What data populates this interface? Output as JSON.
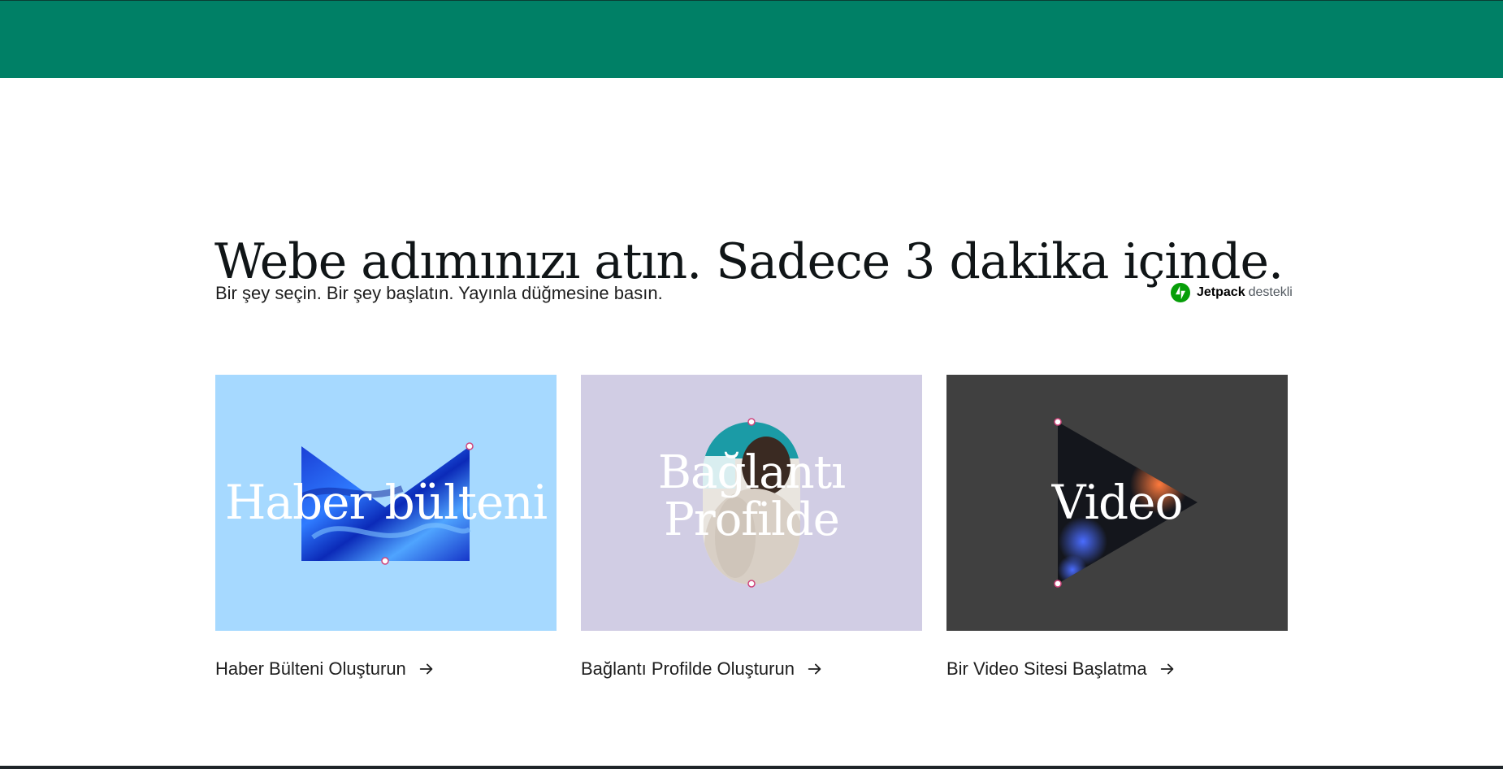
{
  "header": {
    "brand_color": "#008066"
  },
  "hero": {
    "headline": "Webe adımınızı atın. Sadece 3 dakika içinde.",
    "subheadline": "Bir şey seçin. Bir şey başlatın. Yayınla düğmesine basın.",
    "badge": {
      "icon": "jetpack-icon",
      "name": "Jetpack",
      "suffix": "destekli",
      "color": "#069e08"
    }
  },
  "cards": [
    {
      "title": "Haber bülteni",
      "link": "Haber Bülteni Oluşturun",
      "background": "#a6d9ff",
      "shape": "envelope"
    },
    {
      "title": "Bağlantı Profilde",
      "link": "Bağlantı Profilde Oluşturun",
      "background": "#d1cde4",
      "shape": "oval"
    },
    {
      "title": "Video",
      "link": "Bir Video Sitesi Başlatma",
      "background": "#404040",
      "shape": "play-triangle"
    }
  ]
}
